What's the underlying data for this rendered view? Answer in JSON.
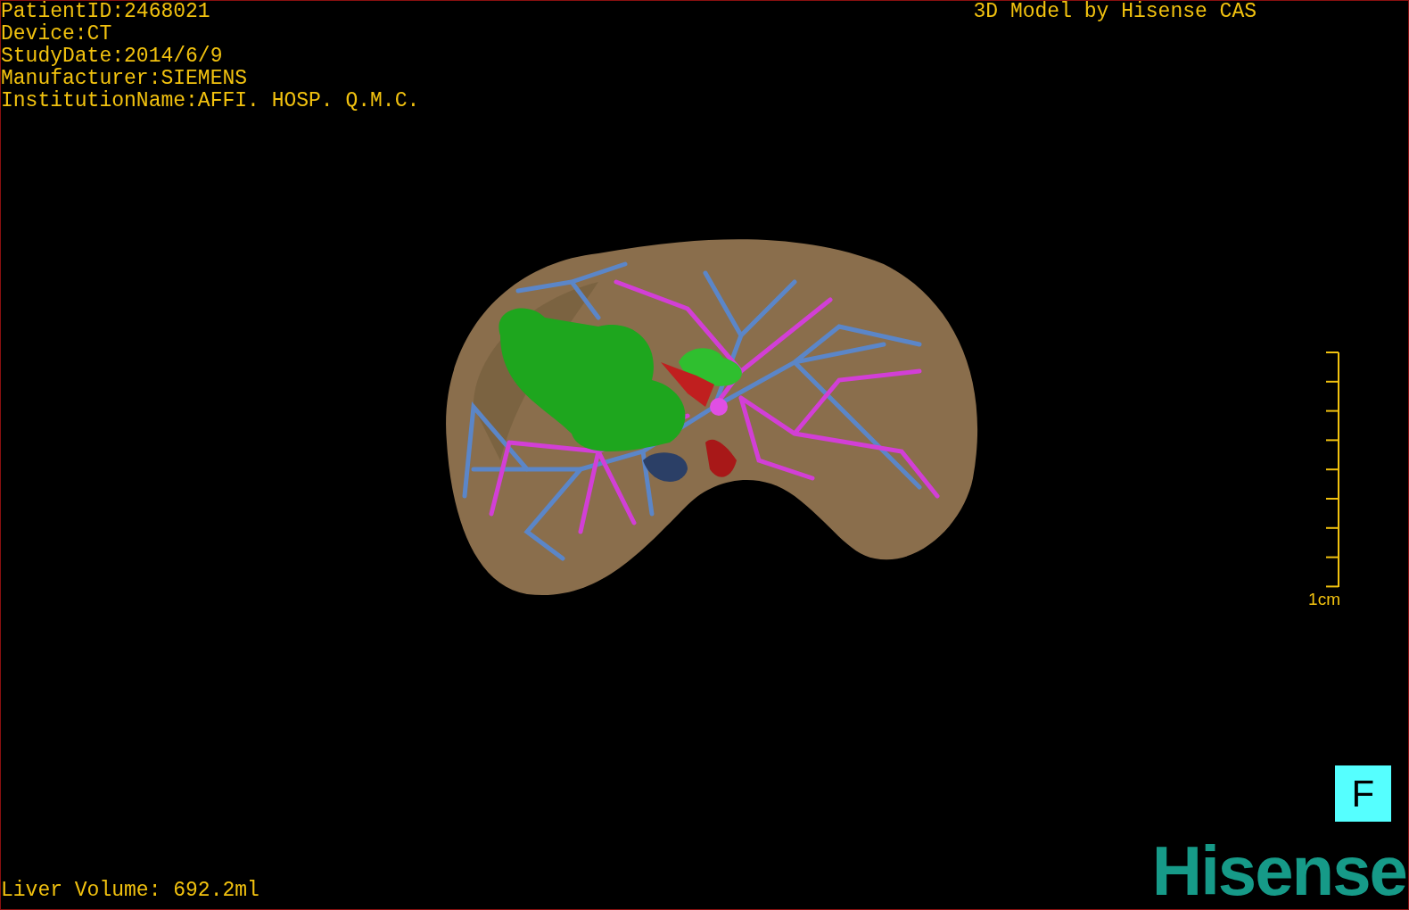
{
  "study_info": [
    "PatientID:2468021",
    "Device:CT",
    "StudyDate:2014/6/9",
    "Manufacturer:SIEMENS",
    "InstitutionName:AFFI. HOSP. Q.M.C."
  ],
  "title": "3D Model by Hisense CAS",
  "scale_bar": {
    "label": "1cm"
  },
  "view_orientation": "F",
  "logo": "Hisense",
  "liver_volume": "Liver Volume: 692.2ml"
}
